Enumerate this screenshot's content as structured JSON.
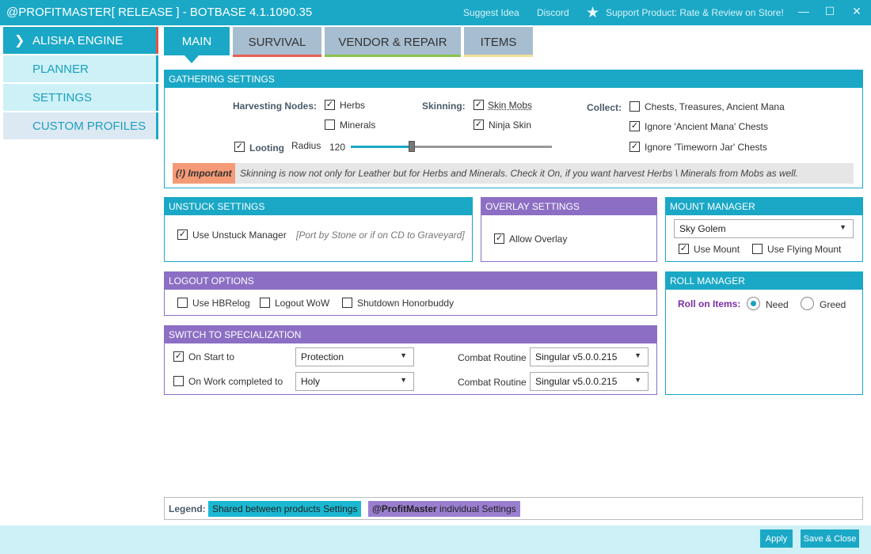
{
  "window": {
    "title": "@PROFITMASTER[ RELEASE ] - BOTBASE 4.1.1090.35",
    "suggest_idea": "Suggest Idea",
    "discord": "Discord",
    "support": "Support Product: Rate & Review on Store!",
    "minimize": "—",
    "maximize": "☐",
    "close": "✕"
  },
  "sidebar": {
    "items": [
      {
        "label": "ALISHA ENGINE",
        "active": true
      },
      {
        "label": "PLANNER"
      },
      {
        "label": "SETTINGS"
      },
      {
        "label": "CUSTOM PROFILES"
      }
    ]
  },
  "tabs": [
    {
      "label": "MAIN",
      "active": true
    },
    {
      "label": "SURVIVAL",
      "accent": "#e8604f"
    },
    {
      "label": "VENDOR & REPAIR",
      "accent": "#8bc34a"
    },
    {
      "label": "ITEMS",
      "accent": "#f0e199"
    }
  ],
  "gathering": {
    "title": "GATHERING SETTINGS",
    "harvesting_label": "Harvesting Nodes:",
    "herbs": "Herbs",
    "herbs_checked": true,
    "minerals": "Minerals",
    "minerals_checked": false,
    "skinning_label": "Skinning:",
    "skin_mobs": "Skin Mobs",
    "skin_mobs_checked": true,
    "ninja_skin": "Ninja Skin",
    "ninja_skin_checked": true,
    "collect_label": "Collect:",
    "chests": "Chests, Treasures, Ancient Mana",
    "chests_checked": false,
    "ignore_mana": "Ignore 'Ancient Mana' Chests",
    "ignore_mana_checked": true,
    "ignore_timeworn": "Ignore 'Timeworn Jar' Chests",
    "ignore_timeworn_checked": true,
    "looting": "Looting",
    "looting_checked": true,
    "radius_label": "Radius",
    "radius_value": "120",
    "radius_fraction": 0.3,
    "important_label": "(!) Important",
    "important_text": "Skinning is now not only for Leather but for Herbs and Minerals. Check it On, if you want harvest Herbs \\ Minerals from Mobs as well."
  },
  "unstuck": {
    "title": "UNSTUCK SETTINGS",
    "use_unstuck": "Use Unstuck Manager",
    "use_unstuck_checked": true,
    "hint": "[Port by Stone or if on CD to Graveyard]"
  },
  "overlay": {
    "title": "OVERLAY SETTINGS",
    "allow_overlay": "Allow Overlay",
    "allow_overlay_checked": true
  },
  "mount": {
    "title": "MOUNT MANAGER",
    "selected": "Sky Golem",
    "use_mount": "Use Mount",
    "use_mount_checked": true,
    "use_flying": "Use Flying Mount",
    "use_flying_checked": false
  },
  "logout": {
    "title": "LOGOUT OPTIONS",
    "hbrelog": "Use HBRelog",
    "logout_wow": "Logout WoW",
    "shutdown": "Shutdown Honorbuddy"
  },
  "roll": {
    "title": "ROLL MANAGER",
    "roll_label": "Roll on Items:",
    "need": "Need",
    "greed": "Greed",
    "selected": "need"
  },
  "spec": {
    "title": "SWITCH TO SPECIALIZATION",
    "on_start": "On Start to",
    "on_start_checked": true,
    "on_start_spec": "Protection",
    "on_work": "On Work completed to",
    "on_work_checked": false,
    "on_work_spec": "Holy",
    "combat_label": "Combat Routine",
    "combat_1": "Singular v5.0.0.215",
    "combat_2": "Singular v5.0.0.215"
  },
  "legend": {
    "label": "Legend:",
    "shared": "Shared between products Settings",
    "individual_bold": "@ProfitMaster",
    "individual_rest": " individual Settings"
  },
  "footer": {
    "apply": "Apply",
    "save_close": "Save & Close"
  },
  "colors": {
    "accent": "#1aa8c6",
    "purple": "#8c6fc4",
    "light": "#cdf1f6"
  }
}
